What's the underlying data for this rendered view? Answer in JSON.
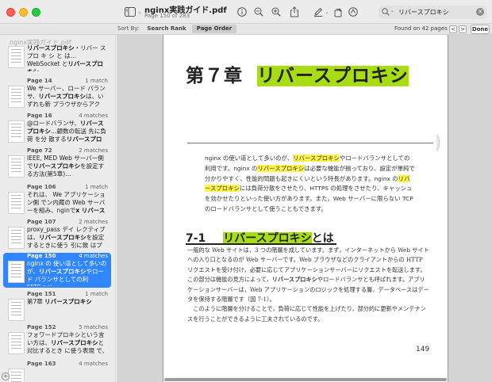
{
  "toolbar": {
    "title": "nginx実践ガイド.pdf",
    "subtitle": "Page 150 of 283",
    "search_value": "リバースプロキシ"
  },
  "search_bar": {
    "sort_by_label": "Sort By:",
    "search_rank_label": "Search Rank",
    "page_order_label": "Page Order",
    "found_text": "Found on 42 pages",
    "prev_label": "<",
    "next_label": ">",
    "done_label": "Done"
  },
  "sidebar": {
    "file_label": "nginx実践ガイド.pdf",
    "results": [
      {
        "page": "",
        "count": "",
        "snippet_html": "<b>リバースプロキシ</b>・リバー ス プロ キ シ と は…WebSocket と<b>リバースプロキシ</b>",
        "selected": false
      },
      {
        "page": "Page 14",
        "count": "1 match",
        "snippet_html": "We サーバー、ロード バランサ、<b>リバースプロキシ</b>は、いずれも新 ブラウザからアクセ…",
        "selected": false
      },
      {
        "page": "Page 16",
        "count": "4 matches",
        "snippet_html": "@ロードバランサ、<b>リバース プロキシ</b>…顧数の転送 先に負荷 を分 散する<b>リバースプロキ…</b>",
        "selected": false
      },
      {
        "page": "Page 72",
        "count": "2 matches",
        "snippet_html": "IEEE, MED Web サーバー側で<b>リバースプロキシ</b>を設定する方法(第5章)…",
        "selected": false
      },
      {
        "page": "Page 106",
        "count": "1 match",
        "snippet_html": "それは、 We アプリケーション側 でン内蔵の Web サーバーを組み、nginで<b>x リバースプ…</b>",
        "selected": false
      },
      {
        "page": "Page 107",
        "count": "2 matches",
        "snippet_html": "proxy_pass デイ レクティブ は、<b>リバースプロキシ</b>を設定するときに使う 引に致 はプロ…",
        "selected": false
      },
      {
        "page": "Page 150",
        "count": "4 matches",
        "snippet_html": "nginx の 使い道として多いのが、<b>リバースプロキシ</b>やロード バランサとしての利 FATS.ngi…",
        "selected": true
      },
      {
        "page": "Page 151",
        "count": "1 match",
        "snippet_html": "第7章 <b>リバースプロキシ</b>",
        "selected": false
      },
      {
        "page": "Page 152",
        "count": "5 matches",
        "snippet_html": "フォワードプロキシという言い方は、<b>リバースプロキシ</b>と対比するとき に使う表現 で、単に…",
        "selected": false
      },
      {
        "page": "Page 163",
        "count": "4 matches",
        "snippet_html": "",
        "selected": false
      }
    ]
  },
  "page": {
    "chapter_prefix": "第７章",
    "chapter_highlight": "リバースプロキシ",
    "intro_html": "nginx の使い道として多いのが、<span class=\"hl-y\">リバースプロキシ</span>やロードバランサとしての利用です。nginx の<span class=\"hl-y\">リバースプロキシ</span>は必要な機能が揃っており、設定が単純で分かりやすく、性能的問題も起きにくいという特長があります。nginx の<span class=\"hl-y\">リバースプロキシ</span>には負荷分散をさせたり、HTTPS の処理をさせたり、キャッシュを効かせたりといった使い方があります。また，Web サーバーに限らない TCP のロードバランサとして使うこともできます。",
    "section_num": "7-1",
    "section_highlight": "リバースプロキシ",
    "section_suffix": "とは",
    "body_html": "一般的な Web サイトは，3 つの階層を成しています。まず，インターネットから Web サイトへの入り口となるのが Web サーバーです。Web ブラウザなどのクライアントからの HTTP リクエストを受け付け，必要に応じてアプリケーションサーバーにリクエストを転送します。この部分は機能の見方によって，<b>リバースプロキシ</b>やロードバランサとも呼ばれます。アプリケーションサーバーは，Web アプリケーションのロジックを処理する層，データベースはデータを保持する階層です（図 7-1）。<br>　このように階層を分けることで，負荷に応じて性能を上げたり，部分的に更新やメンテナンスを行うことができるように工夫されているのです。",
    "page_number": "149"
  }
}
